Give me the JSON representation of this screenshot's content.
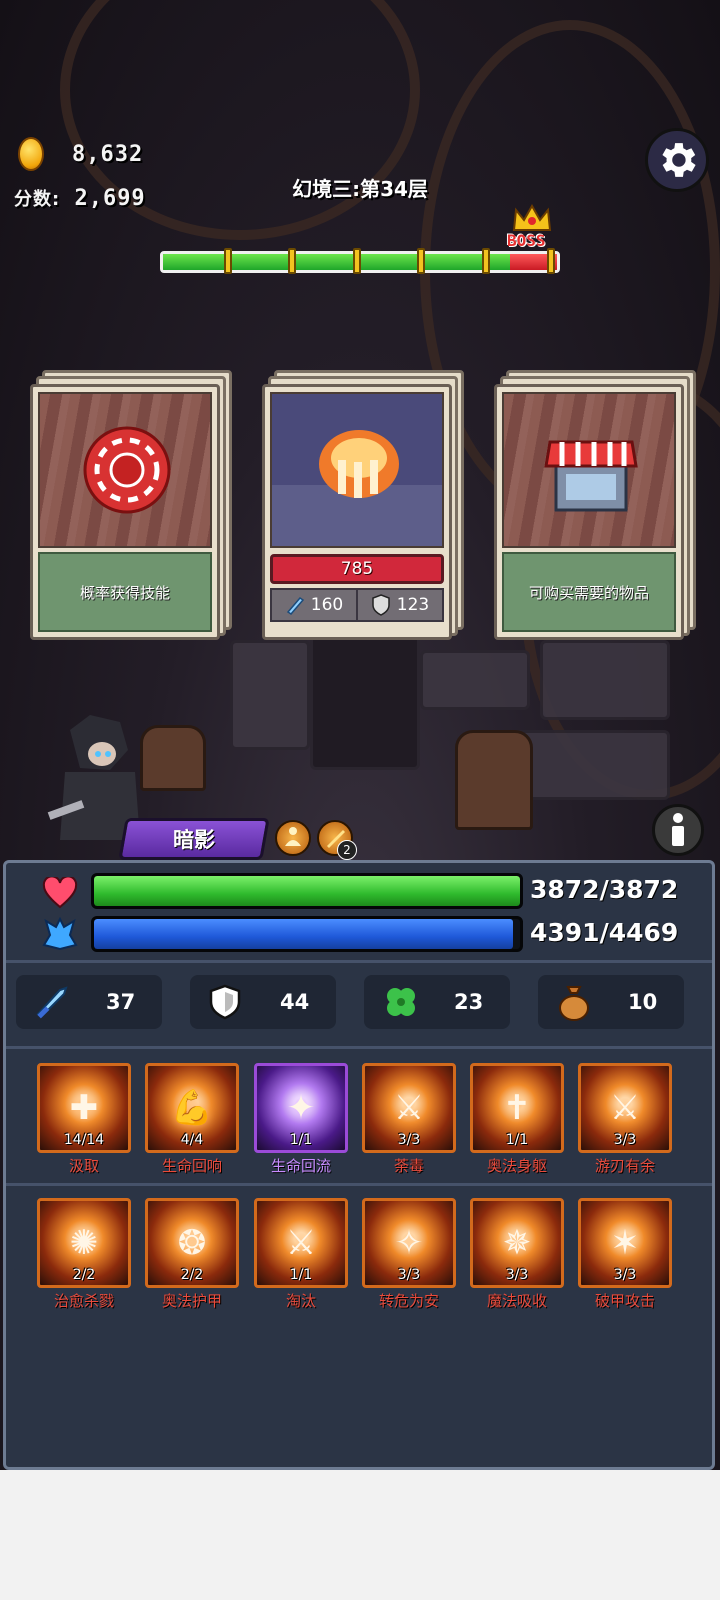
{
  "hud": {
    "coins": "8,632",
    "score_label": "分数:",
    "score": "2,699",
    "level_title": "幻境三:第34层",
    "boss_label": "BOSS",
    "progress_fraction": 0.88,
    "progress_markers": 6
  },
  "cards": [
    {
      "type": "skill",
      "icon": "poker-chip-icon",
      "desc": "概率获得技能"
    },
    {
      "type": "enemy",
      "icon": "fire-monster-icon",
      "hp": "785",
      "attack": "160",
      "defense": "123"
    },
    {
      "type": "shop",
      "icon": "shop-icon",
      "desc": "可购买需要的物品"
    }
  ],
  "hero": {
    "name": "暗影",
    "buff_count": "2"
  },
  "bars": {
    "hp": {
      "text": "3872/3872",
      "fraction": 1.0,
      "icon": "heart-icon"
    },
    "mp": {
      "text": "4391/4469",
      "fraction": 0.9825,
      "icon": "mana-icon"
    }
  },
  "stats": [
    {
      "icon": "sword-icon",
      "value": "37"
    },
    {
      "icon": "shield-icon",
      "value": "44"
    },
    {
      "icon": "clover-icon",
      "value": "23"
    },
    {
      "icon": "money-bag-icon",
      "value": "10"
    }
  ],
  "skills_row1": [
    {
      "count": "14/14",
      "name": "汲取",
      "glyph": "✚"
    },
    {
      "count": "4/4",
      "name": "生命回响",
      "glyph": "💪"
    },
    {
      "count": "1/1",
      "name": "生命回流",
      "glyph": "✦",
      "highlight": true
    },
    {
      "count": "3/3",
      "name": "荼毒",
      "glyph": "⚔"
    },
    {
      "count": "1/1",
      "name": "奥法身躯",
      "glyph": "✝"
    },
    {
      "count": "3/3",
      "name": "游刃有余",
      "glyph": "⚔"
    }
  ],
  "skills_row2": [
    {
      "count": "2/2",
      "name": "治愈杀戮",
      "glyph": "✺"
    },
    {
      "count": "2/2",
      "name": "奥法护甲",
      "glyph": "❂"
    },
    {
      "count": "1/1",
      "name": "淘汰",
      "glyph": "⚔"
    },
    {
      "count": "3/3",
      "name": "转危为安",
      "glyph": "✧"
    },
    {
      "count": "3/3",
      "name": "魔法吸收",
      "glyph": "✵"
    },
    {
      "count": "3/3",
      "name": "破甲攻击",
      "glyph": "✶"
    }
  ],
  "colors": {
    "hp_bar": "#2fba2d",
    "mp_bar": "#1e58d8",
    "enemy_hp": "#d1283b",
    "skill_name": "#e94b3c",
    "skill_highlight": "#c88cff",
    "hero_tag": "#6a36b8"
  }
}
